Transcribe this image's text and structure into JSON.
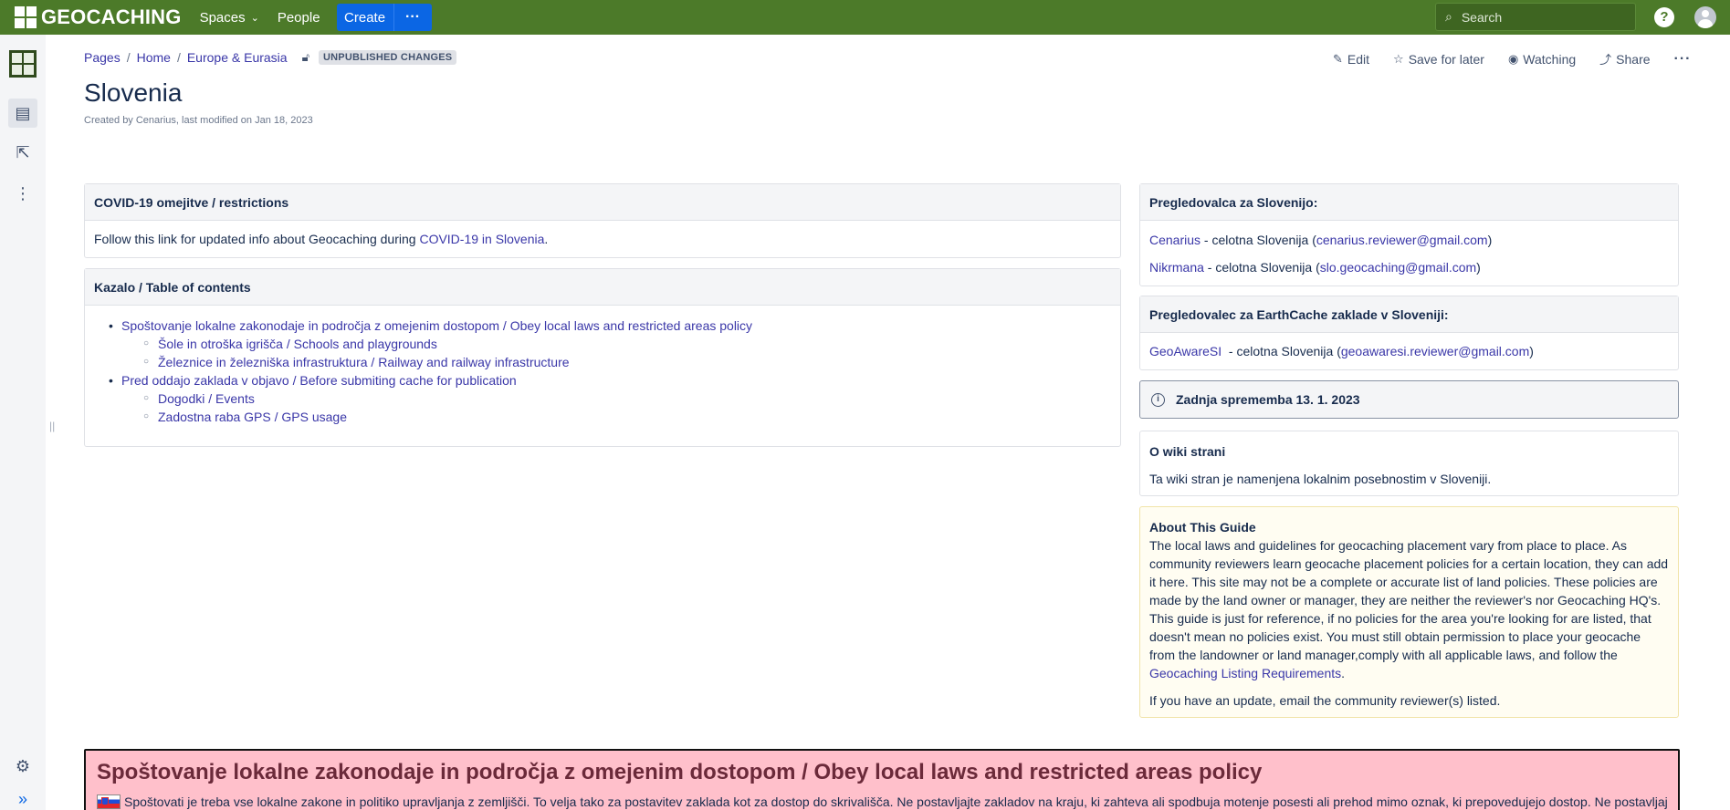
{
  "topbar": {
    "logo": "GEOCACHING",
    "nav": [
      "Spaces",
      "People"
    ],
    "create": "Create",
    "more": "···",
    "search_placeholder": "Search",
    "help": "?"
  },
  "breadcrumb": [
    "Pages",
    "Home",
    "Europe & Eurasia"
  ],
  "badge": "UNPUBLISHED CHANGES",
  "actions": {
    "edit": "Edit",
    "save": "Save for later",
    "watch": "Watching",
    "share": "Share",
    "more": "···"
  },
  "page": {
    "title": "Slovenia",
    "byline": "Created by Cenarius, last modified on Jan 18, 2023"
  },
  "covid": {
    "title": "COVID-19 omejitve / restrictions",
    "text": "Follow this link for updated info about Geocaching during ",
    "link": "COVID-19 in Slovenia",
    "end": "."
  },
  "toc": {
    "title": "Kazalo / Table of contents",
    "items": [
      {
        "label": "Spoštovanje lokalne zakonodaje in področja z omejenim dostopom / Obey local laws and restricted areas policy",
        "level": 1
      },
      {
        "label": "Šole in otroška igrišča / Schools and playgrounds",
        "level": 2
      },
      {
        "label": "Železnice in železniška infrastruktura / Railway and railway infrastructure",
        "level": 2
      },
      {
        "label": "Pred oddajo zaklada v objavo / Before submiting cache for publication",
        "level": 1
      },
      {
        "label": "Dogodki / Events",
        "level": 2
      },
      {
        "label": "Zadostna raba GPS / GPS usage",
        "level": 2
      }
    ]
  },
  "reviewers": {
    "title": "Pregledovalca za Slovenijo:",
    "rows": [
      {
        "name": "Cenarius",
        "mid": " - celotna Slovenija (",
        "email": "cenarius.reviewer@gmail.com",
        "end": ")"
      },
      {
        "name": "Nikrmana",
        "mid": " - celotna Slovenija (",
        "email": "slo.geocaching@gmail.com",
        "end": ")"
      }
    ]
  },
  "earth": {
    "title": "Pregledovalec za EarthCache zaklade v Sloveniji:",
    "name": "GeoAwareSI",
    "mid": "  - celotna Slovenija (",
    "email": "geoawaresi.reviewer@gmail.com",
    "end": ")"
  },
  "change": {
    "text": "Zadnja sprememba 13. 1. 2023",
    "icon": "i"
  },
  "wiki": {
    "title": "O wiki strani",
    "text": "Ta wiki stran je namenjena lokalnim posebnostim v Sloveniji."
  },
  "about": {
    "title": "About This Guide",
    "body": "The local laws and guidelines for geocaching placement vary from place to place. As community reviewers learn geocache placement policies for a certain location, they can add it here. This site may not be a complete or accurate list of land policies. These policies are made by the land owner or manager, they are neither the reviewer's nor Geocaching HQ's. This guide is just for reference, if no policies for the area you're looking for are listed, that doesn't mean no policies exist. You must still obtain permission to place your geocache from the landowner or land manager,comply with all applicable laws, and follow the ",
    "link": "Geocaching Listing Requirements",
    "end": ".",
    "update": "If you have an update, email the community reviewer(s) listed."
  },
  "banner": {
    "title": "Spoštovanje lokalne zakonodaje in področja z omejenim dostopom / Obey local laws and restricted areas policy",
    "text": "Spoštovati je treba vse lokalne zakone in politiko upravljanja z zemljišči. To velja tako za postavitev zaklada kot za dostop do skrivališča. Ne postavljajte zakladov na kraju, ki zahteva ali spodbuja motenje posesti ali prehod mimo oznak, ki prepovedujejo dostop. Ne postavljajte"
  }
}
